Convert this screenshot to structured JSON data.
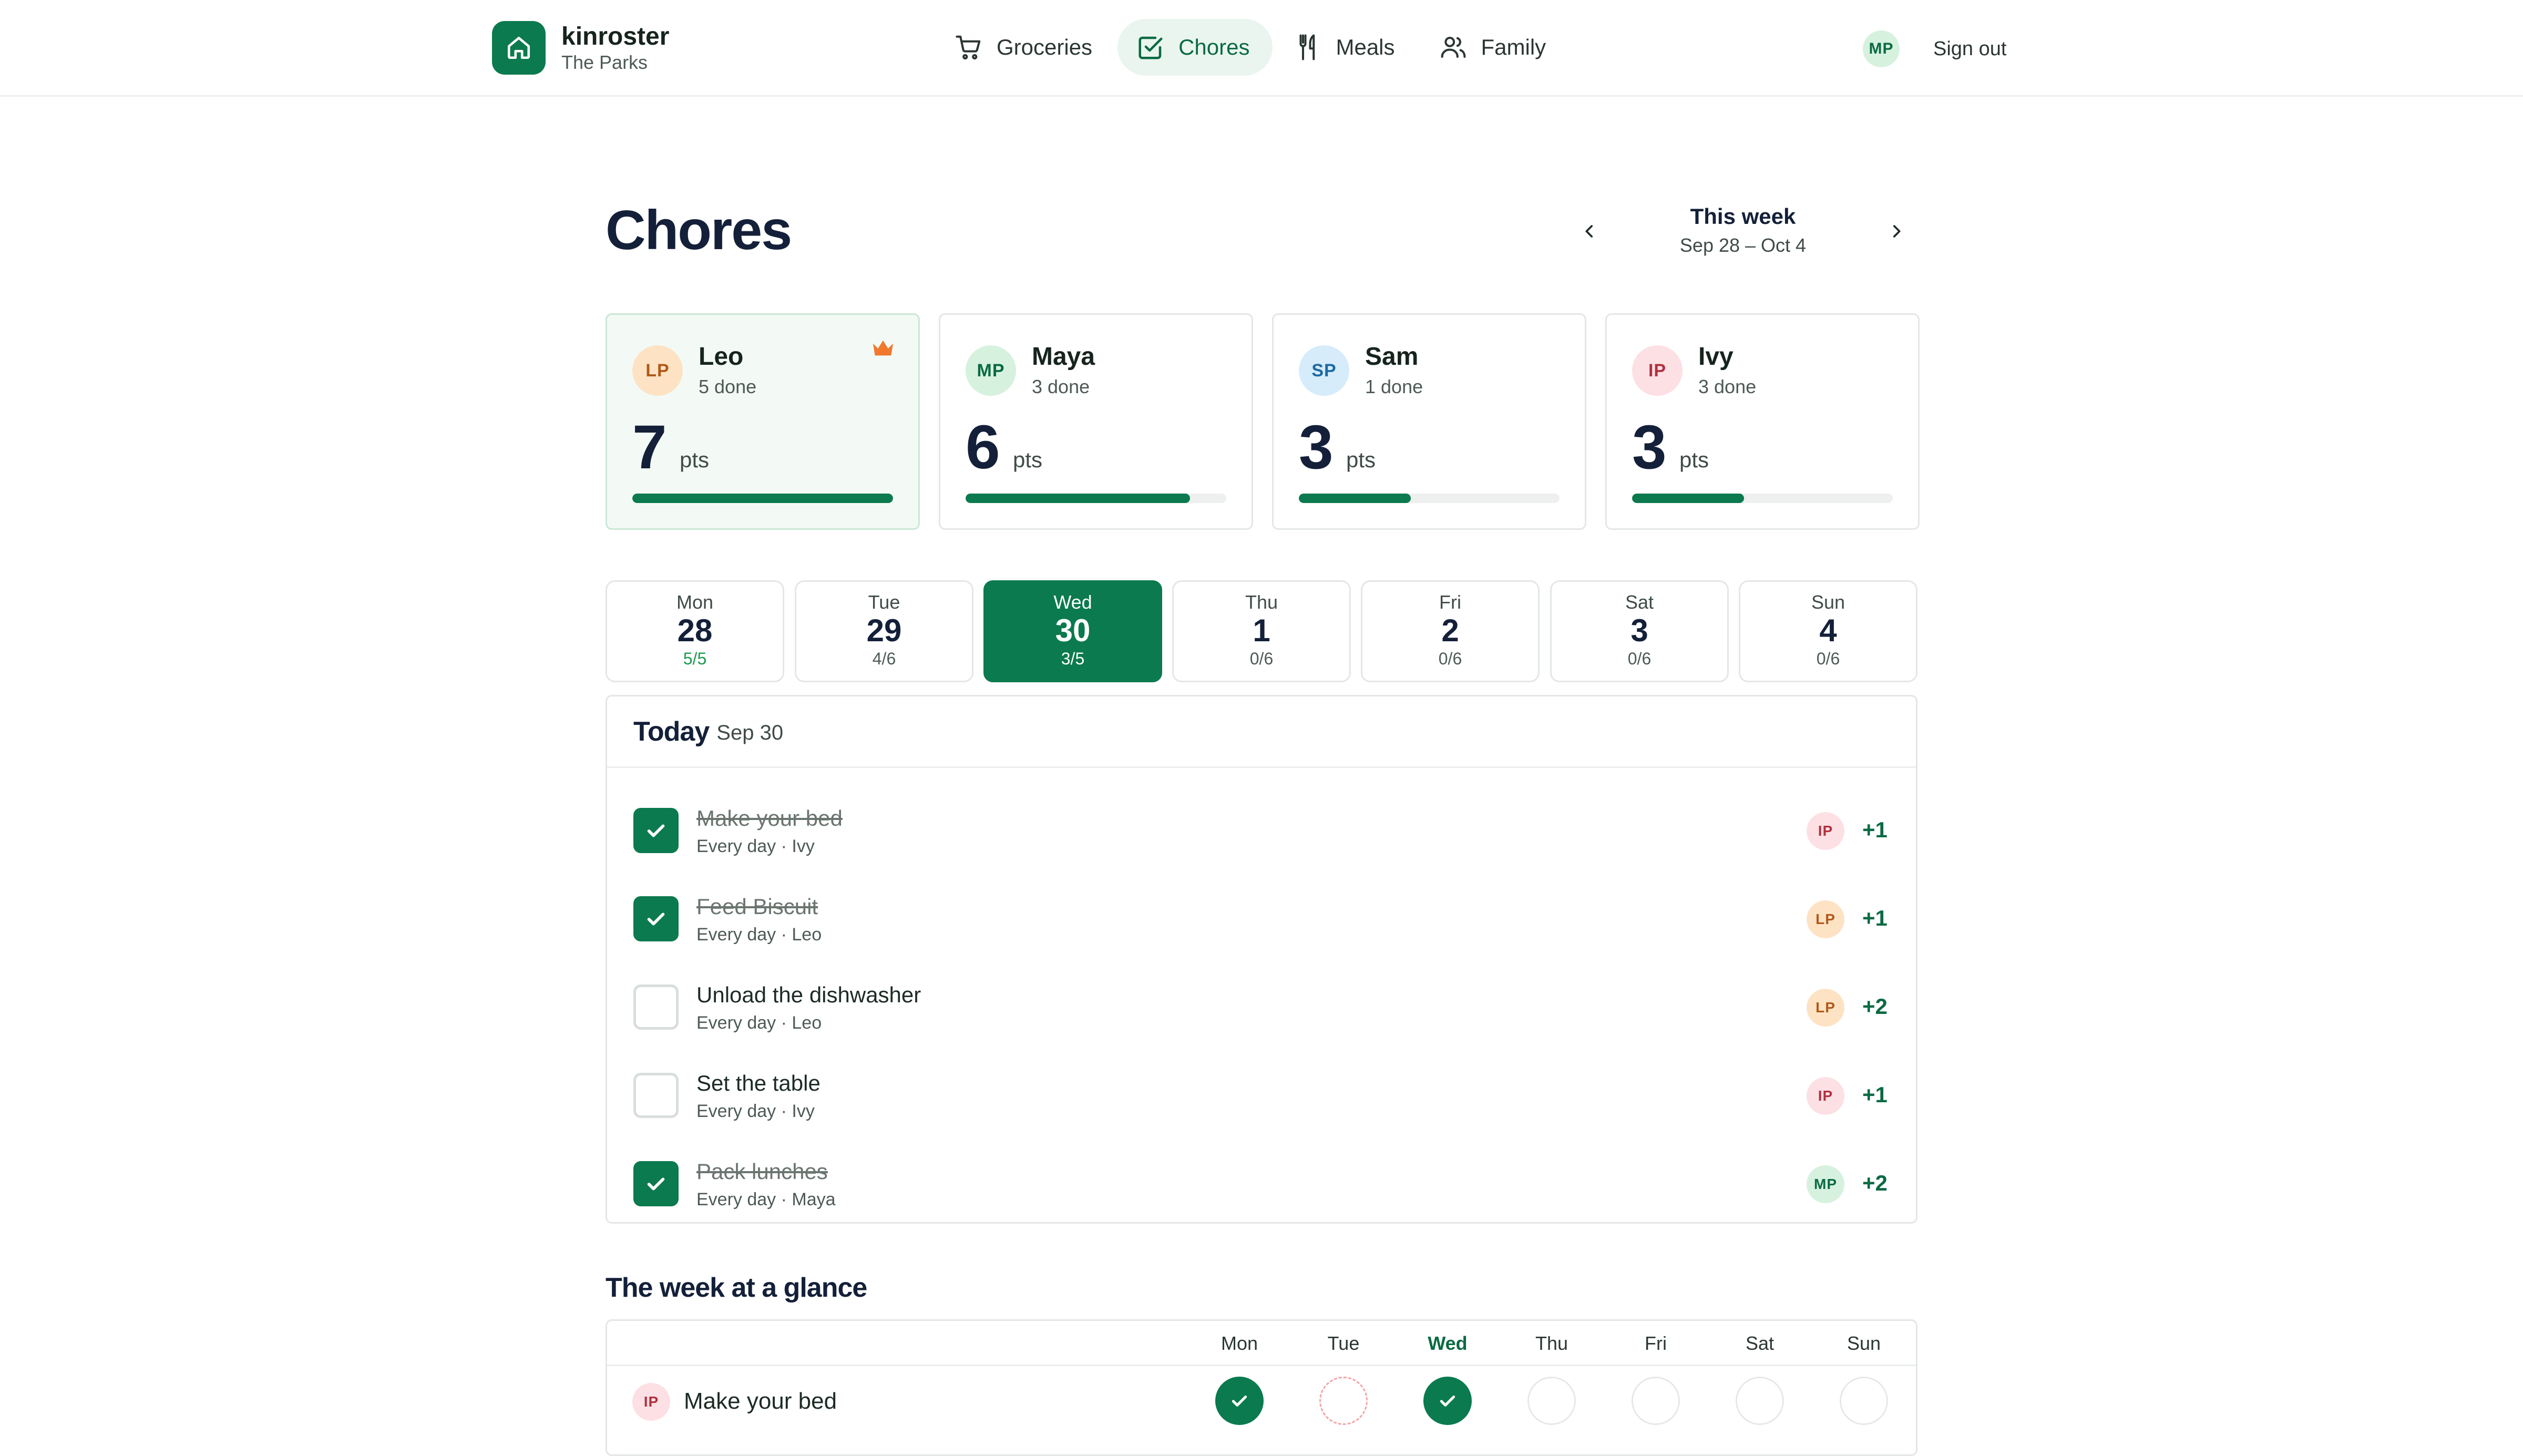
{
  "brand": {
    "name": "kinroster",
    "household": "The Parks"
  },
  "nav": [
    {
      "label": "Groceries",
      "icon": "cart-icon",
      "active": false
    },
    {
      "label": "Chores",
      "icon": "checkbox-icon",
      "active": true
    },
    {
      "label": "Meals",
      "icon": "fork-knife-icon",
      "active": false
    },
    {
      "label": "Family",
      "icon": "people-icon",
      "active": false
    }
  ],
  "user": {
    "initials": "MP",
    "sign_out": "Sign out"
  },
  "page": {
    "title": "Chores"
  },
  "week": {
    "title": "This week",
    "range": "Sep 28 – Oct 4"
  },
  "members": [
    {
      "initials": "LP",
      "name": "Leo",
      "done": "5 done",
      "points": "7",
      "unit": "pts",
      "progress": 1.0,
      "leader": true,
      "color": "#fde3c4",
      "text_color": "#b0591a"
    },
    {
      "initials": "MP",
      "name": "Maya",
      "done": "3 done",
      "points": "6",
      "unit": "pts",
      "progress": 0.86,
      "leader": false,
      "color": "#d7f1df",
      "text_color": "#0b6a43"
    },
    {
      "initials": "SP",
      "name": "Sam",
      "done": "1 done",
      "points": "3",
      "unit": "pts",
      "progress": 0.43,
      "leader": false,
      "color": "#d6ecfb",
      "text_color": "#1d6aa0"
    },
    {
      "initials": "IP",
      "name": "Ivy",
      "done": "3 done",
      "points": "3",
      "unit": "pts",
      "progress": 0.43,
      "leader": false,
      "color": "#fde0e4",
      "text_color": "#b0303f"
    }
  ],
  "days": [
    {
      "name": "Mon",
      "date": "28",
      "count": "5/5",
      "selected": false,
      "complete": true
    },
    {
      "name": "Tue",
      "date": "29",
      "count": "4/6",
      "selected": false,
      "complete": false
    },
    {
      "name": "Wed",
      "date": "30",
      "count": "3/5",
      "selected": true,
      "complete": false
    },
    {
      "name": "Thu",
      "date": "1",
      "count": "0/6",
      "selected": false,
      "complete": false
    },
    {
      "name": "Fri",
      "date": "2",
      "count": "0/6",
      "selected": false,
      "complete": false
    },
    {
      "name": "Sat",
      "date": "3",
      "count": "0/6",
      "selected": false,
      "complete": false
    },
    {
      "name": "Sun",
      "date": "4",
      "count": "0/6",
      "selected": false,
      "complete": false
    }
  ],
  "today": {
    "title": "Today",
    "date": "Sep 30",
    "chores": [
      {
        "title": "Make your bed",
        "subtitle": "Every day · Ivy",
        "done": true,
        "assignee": "IP",
        "points": "+1"
      },
      {
        "title": "Feed Biscuit",
        "subtitle": "Every day · Leo",
        "done": true,
        "assignee": "LP",
        "points": "+1"
      },
      {
        "title": "Unload the dishwasher",
        "subtitle": "Every day · Leo",
        "done": false,
        "assignee": "LP",
        "points": "+2"
      },
      {
        "title": "Set the table",
        "subtitle": "Every day · Ivy",
        "done": false,
        "assignee": "IP",
        "points": "+1"
      },
      {
        "title": "Pack lunches",
        "subtitle": "Every day · Maya",
        "done": true,
        "assignee": "MP",
        "points": "+2"
      }
    ]
  },
  "glance": {
    "title": "The week at a glance",
    "columns": [
      "Mon",
      "Tue",
      "Wed",
      "Thu",
      "Fri",
      "Sat",
      "Sun"
    ],
    "current_column": "Wed",
    "rows": [
      {
        "initials": "IP",
        "label": "Make your bed",
        "status": [
          "done",
          "missed",
          "done",
          "pending",
          "pending",
          "pending",
          "pending"
        ]
      }
    ]
  },
  "colors": {
    "accent": "#0b7a4e",
    "accent_soft": "#eaf5ef",
    "crown": "#f0792e",
    "missed": "#f3a6a6"
  }
}
